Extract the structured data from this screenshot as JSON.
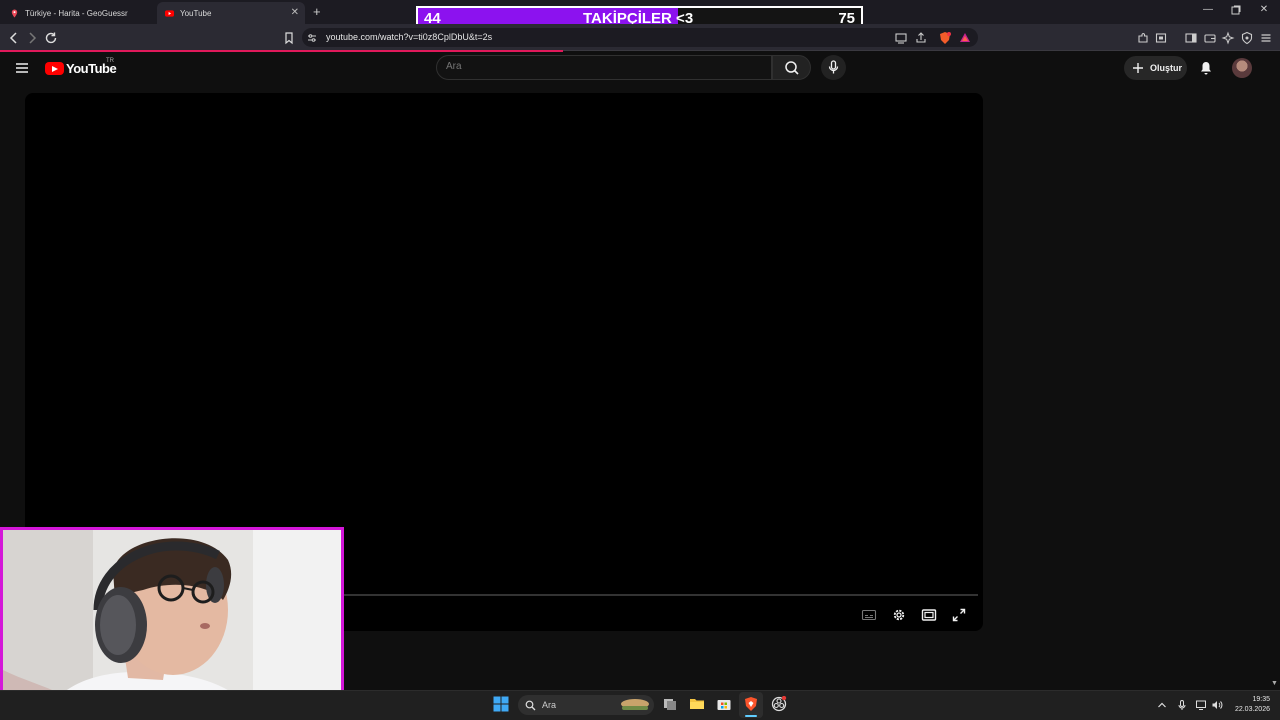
{
  "browser": {
    "tabs": [
      {
        "label": "Türkiye - Harita - GeoGuessr",
        "icon": "map-pin-icon",
        "active": false
      },
      {
        "label": "YouTube",
        "icon": "youtube-icon",
        "active": true
      }
    ],
    "url": "youtube.com/watch?v=ti0z8CplDbU&t=2s",
    "page_load_progress": 0.44
  },
  "overlay": {
    "current": "44",
    "label": "TAKİPÇİLER <3",
    "goal": "75",
    "progress_fraction": 0.587,
    "fill_color": "#8c12ef"
  },
  "youtube": {
    "logo_text": "YouTube",
    "country_code": "TR",
    "search_placeholder": "Ara",
    "create_label": "Oluştur",
    "accent_color": "#ff0000"
  },
  "webcam": {
    "border_color": "#d417d9"
  },
  "taskbar": {
    "search_placeholder": "Ara",
    "time": "19:35",
    "date": "22.03.2026"
  }
}
